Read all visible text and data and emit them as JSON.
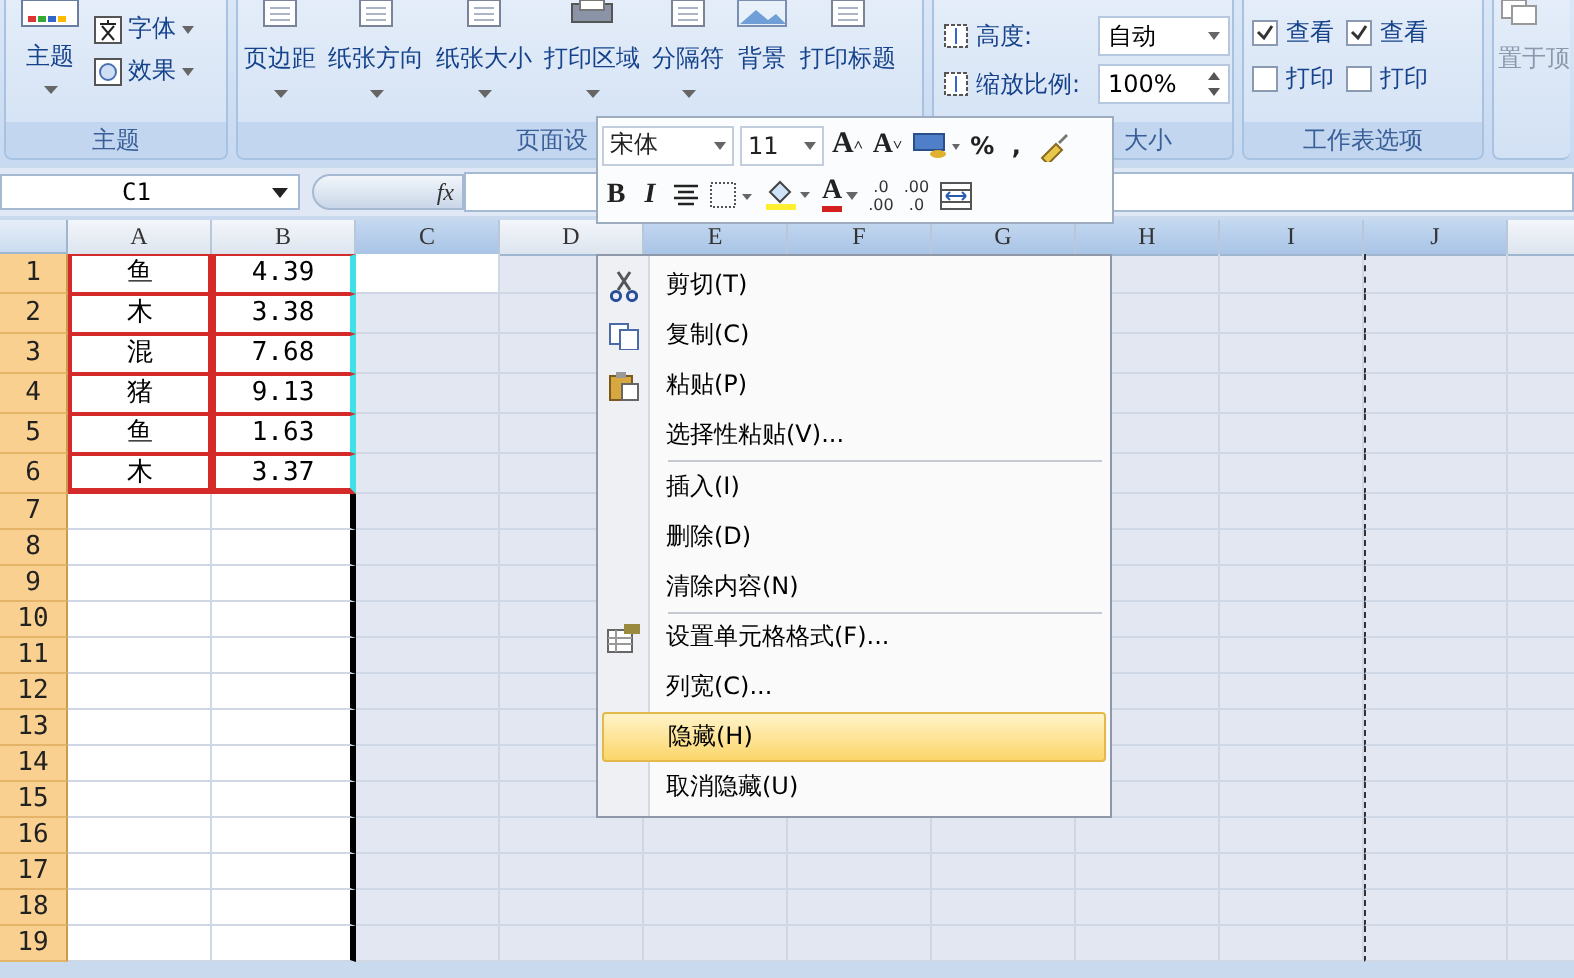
{
  "ribbon": {
    "theme_group": {
      "label": "主题",
      "big_button": {
        "label": "主题",
        "dropdown": true
      },
      "small_buttons": [
        {
          "label": "字体",
          "kind": "font"
        },
        {
          "label": "效果",
          "kind": "effects"
        }
      ]
    },
    "page_setup_group": {
      "label": "页面设",
      "buttons": [
        {
          "label": "页边距",
          "kind": "margins",
          "dropdown": true
        },
        {
          "label": "纸张方向",
          "kind": "orientation",
          "dropdown": true
        },
        {
          "label": "纸张大小",
          "kind": "size",
          "dropdown": true
        },
        {
          "label": "打印区域",
          "kind": "print_area",
          "dropdown": true
        },
        {
          "label": "分隔符",
          "kind": "breaks",
          "dropdown": true
        },
        {
          "label": "背景",
          "kind": "background",
          "dropdown": false
        },
        {
          "label": "打印标题",
          "kind": "titles",
          "dropdown": false
        }
      ]
    },
    "scale_group": {
      "label": "大小",
      "rows": [
        {
          "label": "高度:",
          "value": "自动",
          "kind": "dropdown"
        },
        {
          "label": "缩放比例:",
          "value": "100%",
          "kind": "spinner"
        }
      ]
    },
    "sheet_options_group": {
      "label": "工作表选项",
      "columns": [
        {
          "items": [
            {
              "label": "查看",
              "checked": true
            },
            {
              "label": "打印",
              "checked": false
            }
          ]
        },
        {
          "items": [
            {
              "label": "查看",
              "checked": true
            },
            {
              "label": "打印",
              "checked": false
            }
          ]
        }
      ]
    },
    "arrange_group": {
      "button": "置于顶"
    }
  },
  "formula_bar": {
    "name_box": "C1",
    "function_button": "fx"
  },
  "columns": [
    {
      "label": "A",
      "selected": false
    },
    {
      "label": "B",
      "selected": false
    },
    {
      "label": "C",
      "selected": true
    },
    {
      "label": "D",
      "selected": false
    },
    {
      "label": "E",
      "selected": true
    },
    {
      "label": "F",
      "selected": true
    },
    {
      "label": "G",
      "selected": true
    },
    {
      "label": "H",
      "selected": true
    },
    {
      "label": "I",
      "selected": true
    },
    {
      "label": "J",
      "selected": true
    }
  ],
  "rows": [
    {
      "label": "1",
      "cells": [
        "鱼",
        "4.39"
      ]
    },
    {
      "label": "2",
      "cells": [
        "木",
        "3.38"
      ]
    },
    {
      "label": "3",
      "cells": [
        "混",
        "7.68"
      ]
    },
    {
      "label": "4",
      "cells": [
        "猪",
        "9.13"
      ]
    },
    {
      "label": "5",
      "cells": [
        "鱼",
        "1.63"
      ]
    },
    {
      "label": "6",
      "cells": [
        "木",
        "3.37"
      ]
    },
    {
      "label": "7",
      "cells": []
    },
    {
      "label": "8",
      "cells": []
    },
    {
      "label": "9",
      "cells": []
    },
    {
      "label": "10",
      "cells": []
    },
    {
      "label": "11",
      "cells": []
    },
    {
      "label": "12",
      "cells": []
    },
    {
      "label": "13",
      "cells": []
    },
    {
      "label": "14",
      "cells": []
    },
    {
      "label": "15",
      "cells": []
    },
    {
      "label": "16",
      "cells": []
    },
    {
      "label": "17",
      "cells": []
    },
    {
      "label": "18",
      "cells": []
    },
    {
      "label": "19",
      "cells": []
    }
  ],
  "mini_toolbar": {
    "font": "宋体",
    "size": "11",
    "row1": [
      {
        "kind": "grow_font",
        "label": "A",
        "arrow": "˄"
      },
      {
        "kind": "shrink_font",
        "label": "A",
        "arrow": "˅"
      },
      {
        "kind": "accounting"
      },
      {
        "kind": "text",
        "label": "%"
      },
      {
        "kind": "text",
        "label": ","
      },
      {
        "kind": "painter"
      }
    ],
    "row2": [
      {
        "kind": "bold",
        "label": "B"
      },
      {
        "kind": "italic",
        "label": "I"
      },
      {
        "kind": "center"
      },
      {
        "kind": "borders"
      },
      {
        "kind": "fill_color"
      },
      {
        "kind": "font_color",
        "label": "A"
      },
      {
        "kind": "increase_decimal",
        "top": ".0",
        "bottom": ".00"
      },
      {
        "kind": "decrease_decimal",
        "top": ".00",
        "bottom": ".0"
      },
      {
        "kind": "merge"
      }
    ]
  },
  "context_menu": [
    {
      "label": "剪切(T)",
      "kind": "cut",
      "selected": false,
      "separator_before": false
    },
    {
      "label": "复制(C)",
      "kind": "copy",
      "selected": false,
      "separator_before": false
    },
    {
      "label": "粘贴(P)",
      "kind": "paste",
      "selected": false,
      "separator_before": false
    },
    {
      "label": "选择性粘贴(V)...",
      "kind": "plain",
      "selected": false,
      "separator_before": false
    },
    {
      "label": "插入(I)",
      "kind": "plain",
      "selected": false,
      "separator_before": true
    },
    {
      "label": "删除(D)",
      "kind": "plain",
      "selected": false,
      "separator_before": false
    },
    {
      "label": "清除内容(N)",
      "kind": "plain",
      "selected": false,
      "separator_before": false
    },
    {
      "label": "设置单元格格式(F)...",
      "kind": "format",
      "selected": false,
      "separator_before": true
    },
    {
      "label": "列宽(C)...",
      "kind": "plain",
      "selected": false,
      "separator_before": false
    },
    {
      "label": "隐藏(H)",
      "kind": "plain",
      "selected": true,
      "separator_before": false
    },
    {
      "label": "取消隐藏(U)",
      "kind": "plain",
      "selected": false,
      "separator_before": false
    }
  ]
}
